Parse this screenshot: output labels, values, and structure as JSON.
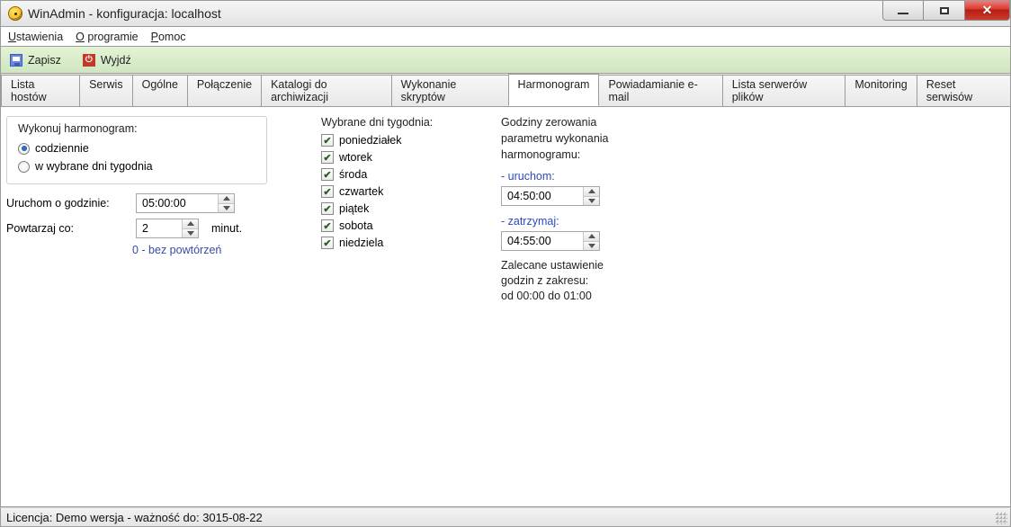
{
  "window": {
    "title": "WinAdmin - konfiguracja: localhost"
  },
  "menu": {
    "ustawienia": "Ustawienia",
    "oprogramie": "O programie",
    "pomoc": "Pomoc"
  },
  "toolbar": {
    "save": "Zapisz",
    "exit": "Wyjdź"
  },
  "tabs": {
    "lista_hostow": "Lista hostów",
    "serwis": "Serwis",
    "ogolne": "Ogólne",
    "polaczenie": "Połączenie",
    "katalogi": "Katalogi do archiwizacji",
    "skrypty": "Wykonanie skryptów",
    "harmonogram": "Harmonogram",
    "email": "Powiadamianie e-mail",
    "serwery": "Lista serwerów plików",
    "monitoring": "Monitoring",
    "reset": "Reset serwisów"
  },
  "schedule_group": {
    "legend": "Wykonuj harmonogram:",
    "daily": "codziennie",
    "selected": "w wybrane dni tygodnia"
  },
  "run_at": {
    "label": "Uruchom o godzinie:",
    "value": "05:00:00"
  },
  "repeat": {
    "label": "Powtarzaj co:",
    "value": "2",
    "unit": "minut.",
    "hint": "0 - bez powtórzeń"
  },
  "days": {
    "header": "Wybrane dni tygodnia:",
    "mon": "poniedziałek",
    "tue": "wtorek",
    "wed": "środa",
    "thu": "czwartek",
    "fri": "piątek",
    "sat": "sobota",
    "sun": "niedziela"
  },
  "reset_hours": {
    "header1": "Godziny zerowania",
    "header2": "parametru wykonania",
    "header3": "harmonogramu:",
    "start_label": "- uruchom:",
    "start_value": "04:50:00",
    "stop_label": "- zatrzymaj:",
    "stop_value": "04:55:00",
    "note1": "Zalecane ustawienie",
    "note2": "godzin z zakresu:",
    "note3": "od 00:00 do 01:00"
  },
  "status": {
    "text": "Licencja: Demo wersja - ważność do: 3015-08-22"
  }
}
